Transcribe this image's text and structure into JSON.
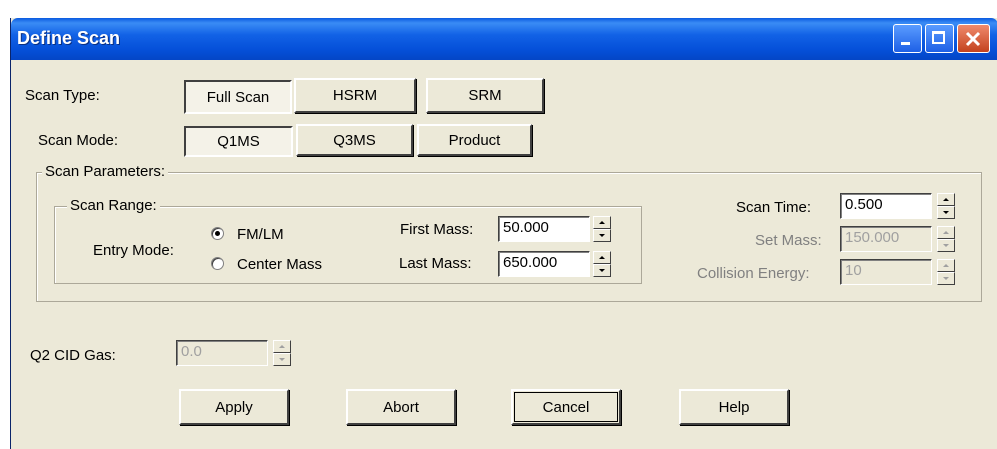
{
  "window": {
    "title": "Define Scan"
  },
  "scan_type": {
    "label": "Scan Type:",
    "options": [
      "Full Scan",
      "HSRM",
      "SRM"
    ],
    "selected": "Full Scan"
  },
  "scan_mode": {
    "label": "Scan Mode:",
    "options": [
      "Q1MS",
      "Q3MS",
      "Product"
    ],
    "selected": "Q1MS"
  },
  "scan_parameters": {
    "legend": "Scan Parameters:",
    "scan_range": {
      "legend": "Scan Range:",
      "entry_mode_label": "Entry Mode:",
      "entry_modes": [
        "FM/LM",
        "Center Mass"
      ],
      "entry_mode_selected": "FM/LM",
      "first_mass_label": "First Mass:",
      "first_mass": "50.000",
      "last_mass_label": "Last Mass:",
      "last_mass": "650.000"
    },
    "scan_time_label": "Scan Time:",
    "scan_time": "0.500",
    "set_mass_label": "Set Mass:",
    "set_mass": "150.000",
    "collision_energy_label": "Collision Energy:",
    "collision_energy": "10"
  },
  "q2_cid_gas": {
    "label": "Q2 CID Gas:",
    "value": "0.0"
  },
  "buttons": {
    "apply": "Apply",
    "abort": "Abort",
    "cancel": "Cancel",
    "help": "Help"
  }
}
